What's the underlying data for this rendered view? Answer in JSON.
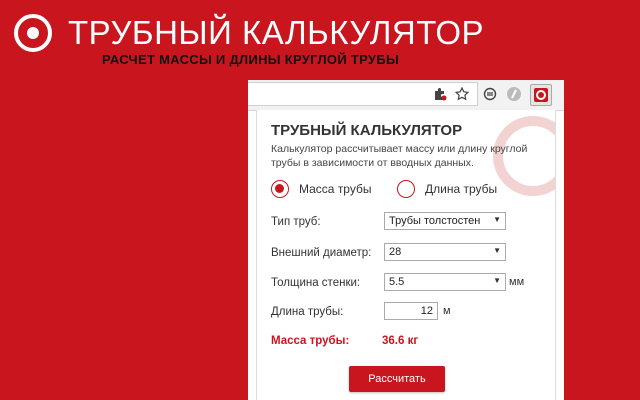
{
  "brand": {
    "title": "ТРУБНЫЙ КАЛЬКУЛЯТОР",
    "subtitle": "РАСЧЕТ МАССЫ И ДЛИНЫ КРУГЛОЙ ТРУБЫ",
    "logo_icon": "ring-logo-icon"
  },
  "colors": {
    "brand_red": "#c8151e",
    "text": "#333333"
  },
  "browser_toolbar": {
    "icons": [
      "puzzle-extension-icon",
      "star-bookmark-icon",
      "sync-icon",
      "tool-extension-icon",
      "pipe-calculator-extension-icon"
    ]
  },
  "popup": {
    "title": "ТРУБНЫЙ КАЛЬКУЛЯТОР",
    "description": "Калькулятор рассчитывает массу или длину круглой трубы в зависимости от вводных данных.",
    "mode": {
      "mass_label": "Масса трубы",
      "length_label": "Длина трубы",
      "selected": "mass"
    },
    "fields": {
      "pipe_type": {
        "label": "Тип труб:",
        "value": "Трубы толстостен"
      },
      "outer_diameter": {
        "label": "Внешний диаметр:",
        "value": "28"
      },
      "wall_thickness": {
        "label": "Толщина стенки:",
        "value": "5.5",
        "unit": "мм"
      },
      "pipe_length": {
        "label": "Длина трубы:",
        "value": "12",
        "unit": "м"
      }
    },
    "result": {
      "label": "Масса трубы:",
      "value": "36.6 кг"
    },
    "calculate_label": "Рассчитать"
  }
}
